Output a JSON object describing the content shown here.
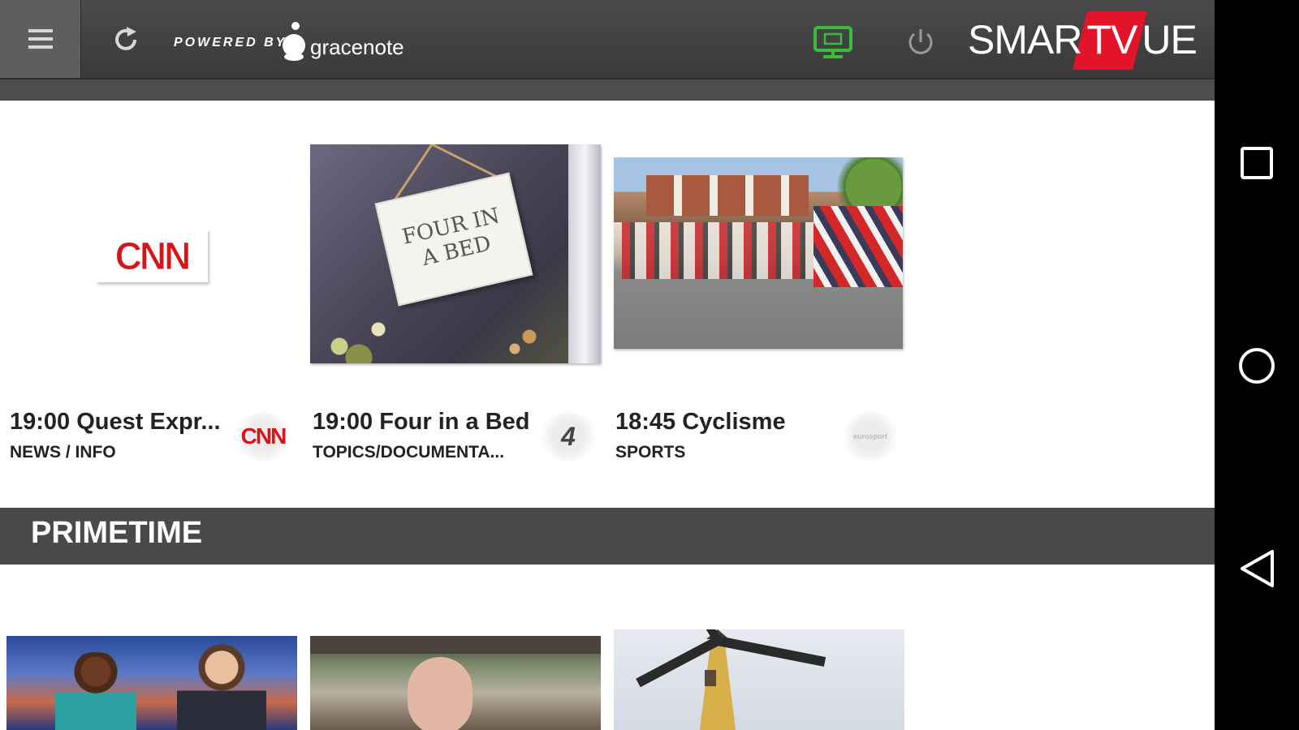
{
  "header": {
    "menu_icon": "hamburger-icon",
    "refresh_icon": "refresh-icon",
    "powered_by": "POWERED BY",
    "provider": "gracenote",
    "cast_icon": "tv-cast-icon",
    "power_icon": "power-icon",
    "brand": {
      "prefix": "SMAR",
      "tv": "TV",
      "suffix": "UE"
    },
    "accent_color": "#e3142a",
    "cast_color": "#3dbb3d"
  },
  "now_playing": [
    {
      "time_title": "19:00 Quest Expr...",
      "genre": "NEWS / INFO",
      "channel_logo": "CNN",
      "image_text": "CNN"
    },
    {
      "time_title": "19:00 Four in a Bed",
      "genre": "TOPICS/DOCUMENTA...",
      "channel_logo": "4",
      "image_text": "FOUR IN A BED"
    },
    {
      "time_title": "18:45 Cyclisme",
      "genre": "SPORTS",
      "channel_logo": "eurosport"
    }
  ],
  "section": {
    "title": "PRIMETIME"
  },
  "system_nav": {
    "recents_icon": "square-icon",
    "home_icon": "circle-icon",
    "back_icon": "triangle-back-icon"
  }
}
